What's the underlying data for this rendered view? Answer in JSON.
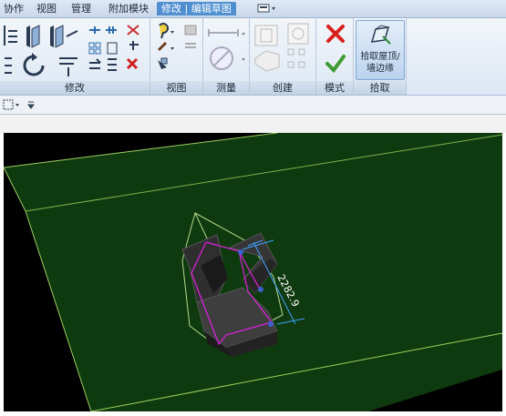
{
  "tabs": [
    {
      "label": "协作",
      "active": false
    },
    {
      "label": "视图",
      "active": false
    },
    {
      "label": "管理",
      "active": false
    },
    {
      "label": "附加模块",
      "active": false
    },
    {
      "label": "修改 | 编辑草图",
      "active": true
    }
  ],
  "panels": {
    "modify": "修改",
    "view": "视图",
    "measure": "测量",
    "create": "创建",
    "mode": "模式",
    "pick": "拾取"
  },
  "pick_button": {
    "line1": "拾取屋顶/",
    "line2": "墙边缘"
  },
  "dimension_label": "2282.9",
  "colors": {
    "ground": "#0f3a0f",
    "sketch": "#e020e0",
    "dimension": "#3fa0ff",
    "edges": "#9ccf5c",
    "cancel": "#d9201c",
    "confirm": "#3d9a2f"
  }
}
